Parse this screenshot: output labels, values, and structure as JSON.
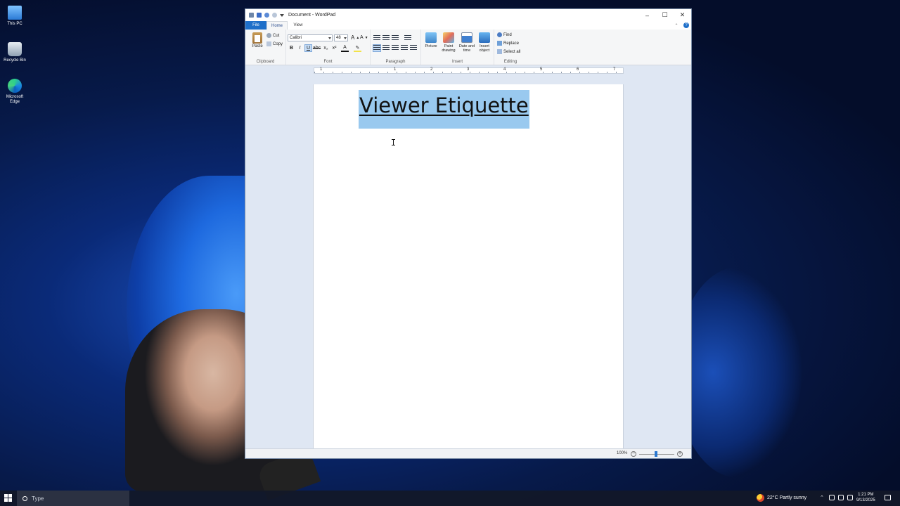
{
  "desktop": {
    "icons": [
      {
        "label": "This PC"
      },
      {
        "label": "Recycle Bin"
      },
      {
        "label": "Microsoft Edge"
      }
    ]
  },
  "window": {
    "title": "Document - WordPad",
    "tabs": {
      "file": "File",
      "home": "Home",
      "view": "View"
    },
    "clipboard": {
      "paste": "Paste",
      "cut": "Cut",
      "copy": "Copy",
      "label": "Clipboard"
    },
    "font": {
      "family": "Calibri",
      "size": "48",
      "label": "Font",
      "bold": "B",
      "italic": "I",
      "underline": "U"
    },
    "paragraph": {
      "label": "Paragraph"
    },
    "insert": {
      "picture": "Picture",
      "paint": "Paint drawing",
      "datetime": "Date and time",
      "object": "Insert object",
      "label": "Insert"
    },
    "editing": {
      "find": "Find",
      "replace": "Replace",
      "select_all": "Select all",
      "label": "Editing"
    },
    "ruler": [
      "1",
      "1",
      "2",
      "3",
      "4",
      "5",
      "6",
      "7"
    ],
    "document": {
      "heading": "Viewer Etiquette"
    },
    "status": {
      "zoom": "100%"
    }
  },
  "taskbar": {
    "search_placeholder": "Type",
    "weather": "22°C  Partly sunny",
    "time": "1:21 PM",
    "date": "9/13/2025"
  }
}
